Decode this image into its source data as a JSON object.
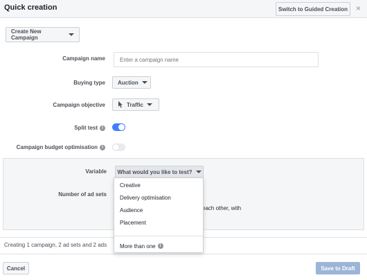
{
  "header": {
    "title": "Quick creation",
    "guided_button": "Switch to Guided Creation",
    "close_glyph": "×"
  },
  "campaign_select": {
    "label": "Create New Campaign"
  },
  "form": {
    "campaign_name": {
      "label": "Campaign name",
      "placeholder": "Enter a campaign name",
      "value": ""
    },
    "buying_type": {
      "label": "Buying type",
      "value": "Auction"
    },
    "campaign_objective": {
      "label": "Campaign objective",
      "value": "Traffic",
      "icon": "cursor-icon"
    },
    "split_test": {
      "label": "Split test",
      "enabled": true
    },
    "budget_optimisation": {
      "label": "Campaign budget optimisation",
      "enabled": false
    }
  },
  "split_test_panel": {
    "variable_label": "Variable",
    "variable_placeholder": "What would you like to test?",
    "ad_sets_label": "Number of ad sets",
    "partial_text": "each other, with"
  },
  "variable_menu": {
    "items": [
      "Creative",
      "Delivery optimisation",
      "Audience",
      "Placement"
    ],
    "more_option": "More than one"
  },
  "summary": "Creating 1 campaign, 2 ad sets and 2 ads",
  "footer": {
    "cancel": "Cancel",
    "save_draft": "Save to Draft"
  },
  "colors": {
    "accent": "#4080ff",
    "disabled_primary": "#9cb4d8",
    "panel_bg": "#f5f6f7"
  }
}
